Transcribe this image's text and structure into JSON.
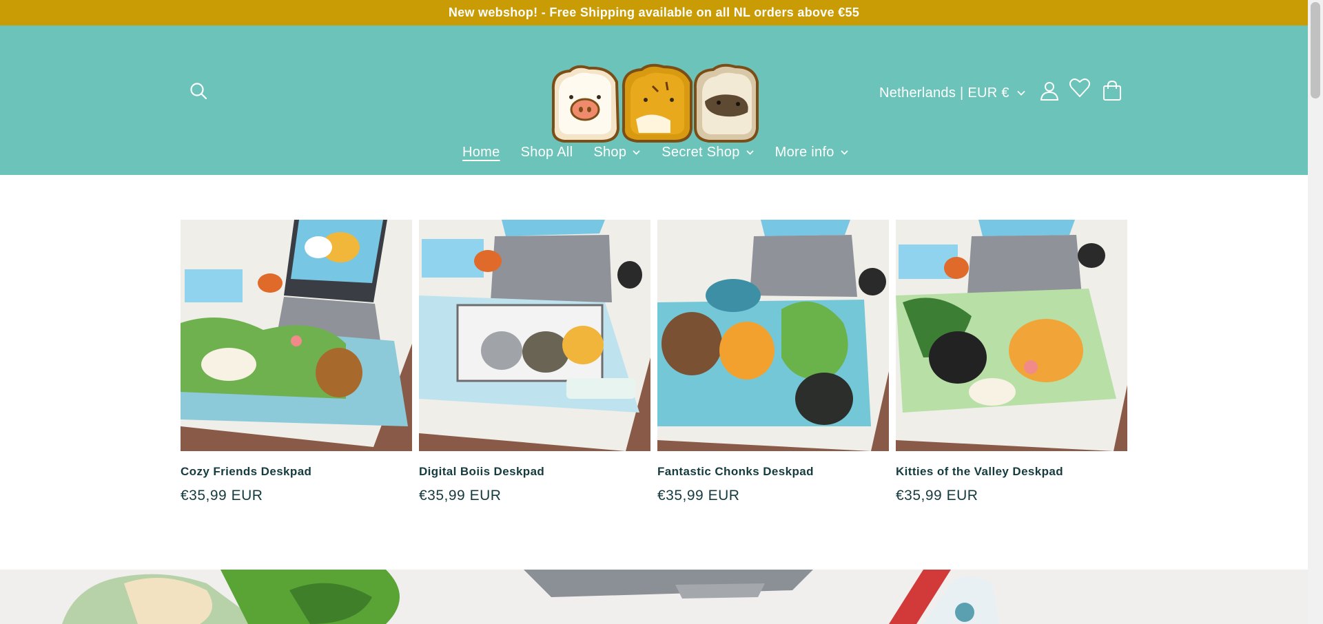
{
  "announcement": "New webshop! - Free Shipping available on all NL orders above €55",
  "header": {
    "country_selector": "Netherlands | EUR €",
    "icons": [
      "search-icon",
      "account-icon",
      "heart-icon",
      "cart-icon"
    ]
  },
  "nav": [
    {
      "label": "Home",
      "active": true,
      "dropdown": false
    },
    {
      "label": "Shop All",
      "active": false,
      "dropdown": false
    },
    {
      "label": "Shop",
      "active": false,
      "dropdown": true
    },
    {
      "label": "Secret Shop",
      "active": false,
      "dropdown": true
    },
    {
      "label": "More info",
      "active": false,
      "dropdown": true
    }
  ],
  "products": [
    {
      "title": "Cozy Friends Deskpad",
      "price": "€35,99 EUR"
    },
    {
      "title": "Digital Boiis Deskpad",
      "price": "€35,99 EUR"
    },
    {
      "title": "Fantastic Chonks Deskpad",
      "price": "€35,99 EUR"
    },
    {
      "title": "Kitties of the Valley Deskpad",
      "price": "€35,99 EUR"
    }
  ],
  "colors": {
    "announcement_bg": "#c99b04",
    "header_bg": "#6cc3b9",
    "text_dark": "#153b3f"
  }
}
